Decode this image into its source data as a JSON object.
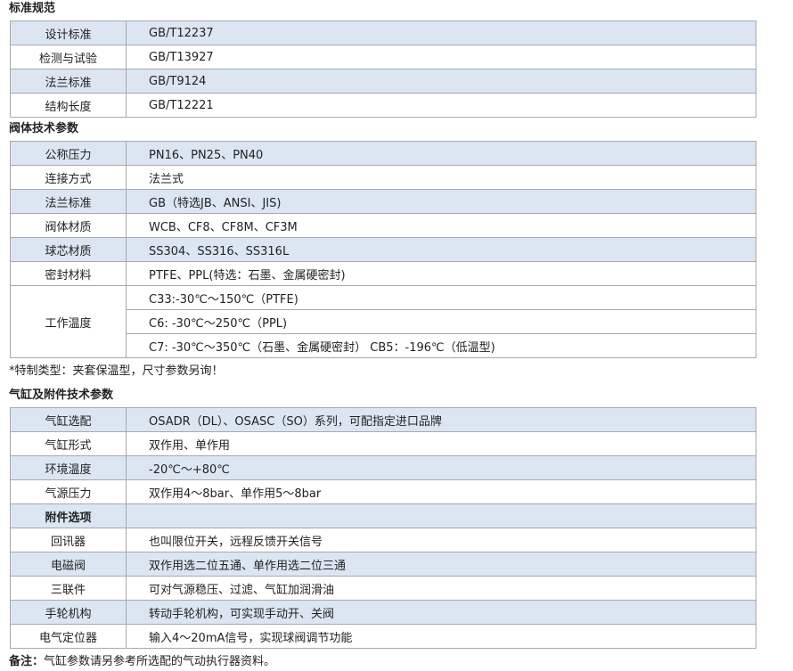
{
  "sections": {
    "standards": {
      "title": "标准规范",
      "rows": [
        {
          "label": "设计标准",
          "value": "GB/T12237"
        },
        {
          "label": "检测与试验",
          "value": "GB/T13927"
        },
        {
          "label": "法兰标准",
          "value": "GB/T9124"
        },
        {
          "label": "结构长度",
          "value": "GB/T12221"
        }
      ]
    },
    "body_params": {
      "title": "阀体技术参数",
      "rows": [
        {
          "label": "公称压力",
          "value": "PN16、PN25、PN40"
        },
        {
          "label": "连接方式",
          "value": "法兰式"
        },
        {
          "label": "法兰标准",
          "value": "GB（特选JB、ANSI、JIS)"
        },
        {
          "label": "阀体材质",
          "value": "WCB、CF8、CF8M、CF3M"
        },
        {
          "label": "球芯材质",
          "value": "SS304、SS316、SS316L"
        },
        {
          "label": "密封材料",
          "value": "PTFE、PPL(特选：石墨、金属硬密封)"
        }
      ],
      "temperature": {
        "label": "工作温度",
        "values": [
          "C33:-30℃～150℃（PTFE)",
          "C6: -30℃～250℃（PPL)",
          "C7: -30℃～350℃（石墨、金属硬密封）  CB5：-196℃（低温型)"
        ]
      }
    },
    "special_note": "*特制类型：夹套保温型，尺寸参数另询！",
    "cylinder_params": {
      "title": "气缸及附件技术参数",
      "rows": [
        {
          "label": "气缸选配",
          "value": "OSADR（DL）、OSASC（SO）系列，可配指定进口品牌"
        },
        {
          "label": "气缸形式",
          "value": "双作用、单作用"
        },
        {
          "label": "环境温度",
          "value": "-20℃～+80℃"
        },
        {
          "label": "气源压力",
          "value": "双作用4～8bar、单作用5～8bar"
        }
      ],
      "accessories_header": {
        "label": "附件选项",
        "value": ""
      },
      "accessories": [
        {
          "label": "回讯器",
          "value": "也叫限位开关，远程反馈开关信号"
        },
        {
          "label": "电磁阀",
          "value": "双作用选二位五通、单作用选二位三通"
        },
        {
          "label": "三联件",
          "value": "可对气源稳压、过滤、气缸加润滑油"
        },
        {
          "label": "手轮机构",
          "value": "转动手轮机构，可实现手动开、关阀"
        },
        {
          "label": "电气定位器",
          "value": "输入4～20mA信号，实现球阀调节功能"
        }
      ]
    },
    "footnote": {
      "prefix": "备注：",
      "text": "气缸参数请另参考所选配的气动执行器资料。"
    }
  },
  "colors": {
    "shade": "#dce6f2",
    "border": "#a9a9a9",
    "text": "#222222"
  }
}
